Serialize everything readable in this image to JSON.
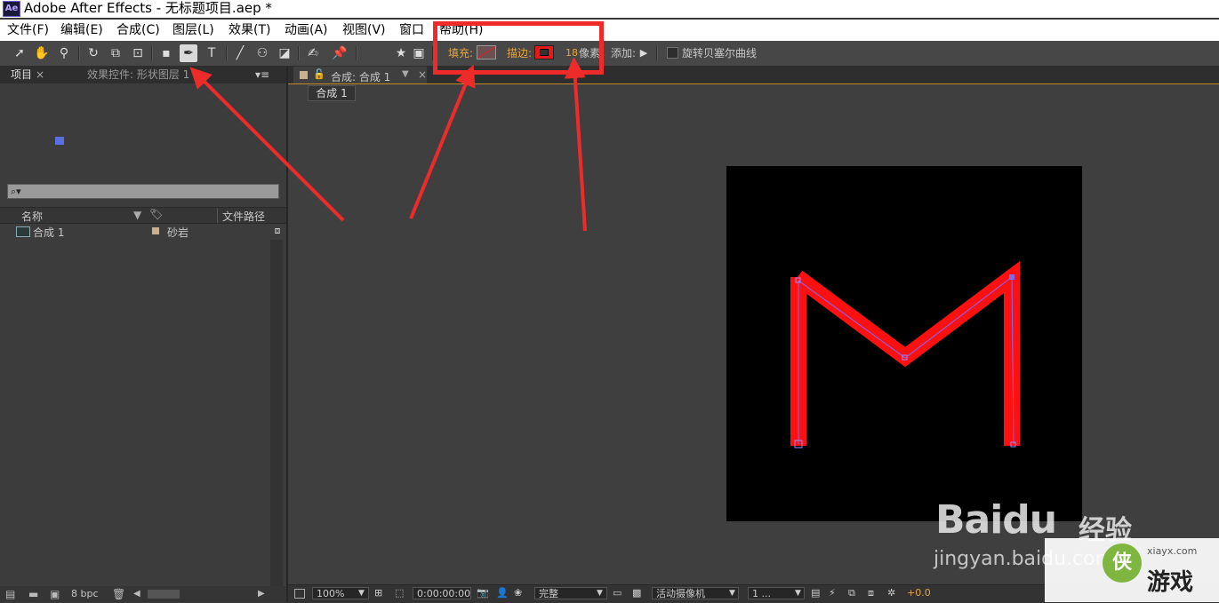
{
  "window": {
    "app_icon_text": "Ae",
    "title": "Adobe After Effects - 无标题项目.aep *"
  },
  "menu": [
    "文件(F)",
    "编辑(E)",
    "合成(C)",
    "图层(L)",
    "效果(T)",
    "动画(A)",
    "视图(V)",
    "窗口",
    "帮助(H)"
  ],
  "toolbar": {
    "fill_label": "填充:",
    "stroke_label": "描边:",
    "stroke_width": "18",
    "stroke_unit": "像素",
    "add_label": "添加:",
    "rotate_bezier_label": "旋转贝塞尔曲线",
    "colors": {
      "fill": "none",
      "stroke": "#e41a1a",
      "highlight": "#ee2b2b"
    }
  },
  "left_panel": {
    "tab_project": "项目",
    "tab_effects": "效果控件: 形状图层 1",
    "search_placeholder": "⌕▾",
    "columns": {
      "name": "名称",
      "path": "文件路径"
    },
    "items": [
      {
        "name": "合成 1",
        "label": "砂岩"
      }
    ],
    "footer_bpc": "8 bpc"
  },
  "comp_panel": {
    "tab_title": "合成: 合成 1",
    "breadcrumb": "合成 1",
    "shape_color": "#ff1010",
    "path_color": "#7a6bff",
    "footer": {
      "zoom": "100%",
      "timecode": "0:00:00:00",
      "resolution": "完整",
      "camera": "活动摄像机",
      "views": "1 ...",
      "exposure": "+0.0"
    }
  },
  "watermark": {
    "logo": "Baidu",
    "jingyan": "经验",
    "url": "jingyan.baidu.com",
    "site": "游戏",
    "site_url": "xiayx.com"
  }
}
